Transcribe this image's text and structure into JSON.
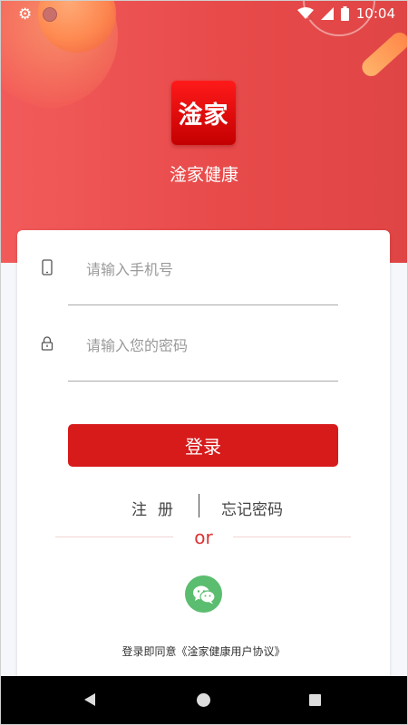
{
  "status_bar": {
    "time": "10:04",
    "icons": [
      "settings-icon",
      "notification-dot-icon",
      "wifi-icon",
      "signal-icon",
      "battery-icon"
    ]
  },
  "app": {
    "logo_text": "淦家",
    "name": "淦家健康"
  },
  "form": {
    "phone": {
      "placeholder": "请输入手机号",
      "icon": "phone-icon"
    },
    "password": {
      "placeholder": "请输入您的密码",
      "icon": "lock-icon"
    },
    "login_label": "登录"
  },
  "links": {
    "register": "注册",
    "forgot_password": "忘记密码"
  },
  "divider_text": "or",
  "social": {
    "wechat_icon": "wechat-icon"
  },
  "agreement": "登录即同意《淦家健康用户协议》",
  "colors": {
    "primary": "#d71a1a",
    "header_gradient": "#f25b5b",
    "wechat": "#5bbd6f",
    "or_text": "#dd3333"
  },
  "nav_bar": [
    "back-icon",
    "home-icon",
    "recents-icon"
  ]
}
